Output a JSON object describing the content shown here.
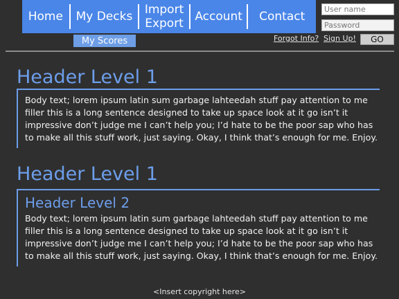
{
  "nav": {
    "home": "Home",
    "my_decks": "My Decks",
    "import_line1": "Import",
    "import_line2": "Export",
    "account": "Account",
    "contact": "Contact",
    "my_scores": "My Scores"
  },
  "login": {
    "username_placeholder": "User name",
    "password_placeholder": "Password",
    "forgot_info": "Forgot Info?",
    "sign_up": "Sign Up!",
    "go": "GO"
  },
  "sections": [
    {
      "h1": "Header Level 1",
      "body": "Body text; lorem ipsum latin sum garbage lahteedah stuff pay attention to me filler this is a long sentence designed to take up space look at it go isn’t it impressive don’t judge me I can’t help you; I’d hate to be the poor sap who has to make all this stuff work, just saying. Okay, I think that’s enough for me. Enjoy."
    },
    {
      "h1": "Header Level 1",
      "h2": "Header Level 2",
      "body": "Body text; lorem ipsum latin sum garbage lahteedah stuff pay attention to me filler this is a long sentence designed to take up space look at it go isn’t it impressive don’t judge me I can’t help you; I’d hate to be the poor sap who has to make all this stuff work, just saying. Okay, I think that’s enough for me. Enjoy."
    }
  ],
  "footer": "<Insert copyright here>",
  "colors": {
    "background": "#2f2f2f",
    "nav": "#4a86e8",
    "sub_nav": "#6d9ee6",
    "heading": "#6d9eeb"
  }
}
